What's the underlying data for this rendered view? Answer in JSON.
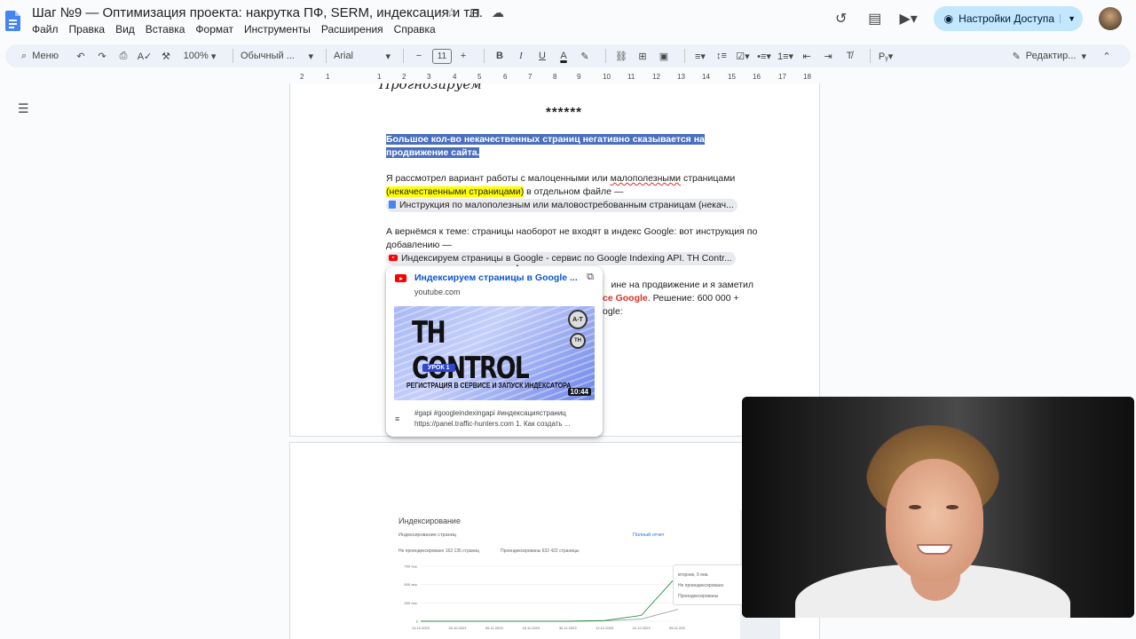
{
  "title_bar": {
    "doc_title": "Шаг №9 — Оптимизация проекта: накрутка ПФ, SERM, индексация и т.п.",
    "menu": [
      "Файл",
      "Правка",
      "Вид",
      "Вставка",
      "Формат",
      "Инструменты",
      "Расширения",
      "Справка"
    ],
    "share_label": "Настройки Доступа"
  },
  "toolbar": {
    "menu_label": "Меню",
    "zoom": "100%",
    "style": "Обычный ...",
    "font": "Arial",
    "font_size": "11",
    "edit_mode": "Редактир..."
  },
  "ruler": [
    "2",
    "1",
    "1",
    "2",
    "3",
    "4",
    "5",
    "6",
    "7",
    "8",
    "9",
    "10",
    "11",
    "12",
    "13",
    "14",
    "15",
    "16",
    "17",
    "18"
  ],
  "document": {
    "cut_heading": "Прогнозируем",
    "stars": "******",
    "p1": "Большое кол-во некачественных страниц негативно сказывается на продвижение сайта.",
    "p2_a": "Я рассмотрел вариант работы с малоценными или ",
    "p2_b": "малополезными",
    "p2_c": " страницами ",
    "p2_hl": "(некачественными страницами)",
    "p2_d": " в отдельном файле —",
    "chip1": "Инструкция по малополезным или маловостребованным страницам (некач...",
    "p3": "А вернёмся к теме: страницы наоборот не входят в индекс Google: вот инструкция по добавлению —",
    "chip2": "Индексируем страницы в Google - сервис по Google Indexing API. TH Contr...",
    "p4_a": "ине на продвижение и я заметил",
    "p4_b": "се Google",
    "p4_c": ". Решение: 600 000 +",
    "p4_d": "ogle:"
  },
  "preview": {
    "title": "Индексируем страницы в Google ...",
    "domain": "youtube.com",
    "thumb_title": "TH CONTROL",
    "thumb_lesson": "УРОК 1",
    "thumb_sub": "РЕГИСТРАЦИЯ В СЕРВИСЕ И ЗАПУСК ИНДЕКСАТОРА",
    "thumb_logo1": "A-T",
    "thumb_logo2": "TH",
    "duration": "10:44",
    "desc1": "#gapi #googleindexingapi #индексациястраниц",
    "desc2": "https://panel.traffic-hunters.com 1. Как создать ..."
  },
  "chart": {
    "title": "Индексирование",
    "subtitle": "Индексирование страниц",
    "link": "Полный отчет",
    "legend_not_indexed": "Не проиндексировано 163 135 страниц",
    "legend_indexed": "Проиндексированы 632 422 страницы",
    "y_ticks": [
      "750 тыс.",
      "500 тыс.",
      "250 тыс.",
      "0"
    ],
    "x_ticks": [
      "13.10.2023",
      "25.10.2023",
      "06.11.2023",
      "18.11.2023",
      "30.11.2023",
      "12.12.2023",
      "24.12.2023",
      "05.01.2024"
    ],
    "tooltip": [
      "вторник, 9 янв.",
      "Не проиндексировано",
      "Проиндексированы"
    ],
    "colors": {
      "not_indexed": "#9aa0a6",
      "indexed": "#1e8e3e"
    }
  },
  "chart_data": {
    "type": "line",
    "title": "Индексирование",
    "x": [
      "13.10.2023",
      "25.10.2023",
      "06.11.2023",
      "18.11.2023",
      "30.11.2023",
      "12.12.2023",
      "24.12.2023",
      "05.01.2024"
    ],
    "ylim": [
      0,
      750000
    ],
    "series": [
      {
        "name": "Не проиндексировано",
        "values": [
          0,
          0,
          0,
          0,
          0,
          5000,
          30000,
          163135
        ]
      },
      {
        "name": "Проиндексированы",
        "values": [
          0,
          0,
          0,
          0,
          0,
          10000,
          80000,
          632422
        ]
      }
    ]
  }
}
